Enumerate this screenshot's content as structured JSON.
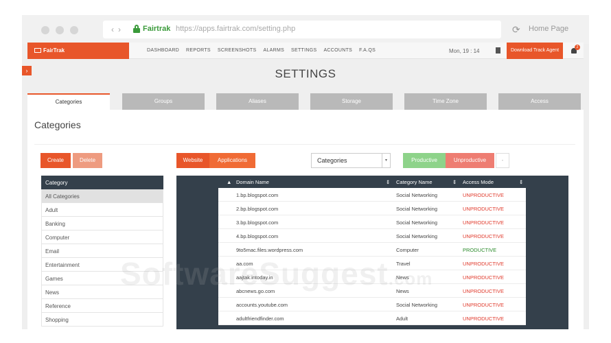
{
  "browser": {
    "site_name": "Fairtrak",
    "url": "https://apps.fairtrak.com/setting.php",
    "home_label": "Home Page"
  },
  "app": {
    "logo": "FairTrak",
    "menu": [
      "DASHBOARD",
      "REPORTS",
      "SCREENSHOTS",
      "ALARMS",
      "SETTINGS",
      "ACCOUNTS",
      "F.A.QS"
    ],
    "time": "Mon, 19 : 14",
    "download_label": "Download Track Agent",
    "notification_count": "2"
  },
  "page": {
    "title": "SETTINGS",
    "tabs": [
      "Categories",
      "Groups",
      "Aliases",
      "Storage",
      "Time Zone",
      "Access"
    ],
    "active_tab": 0,
    "section_title": "Categories"
  },
  "toolbar": {
    "create": "Create",
    "delete": "Delete",
    "website": "Website",
    "applications": "Applications",
    "select_value": "Categories",
    "productive": "Productive",
    "unproductive": "Unproductive",
    "dash": "-"
  },
  "categories": {
    "header": "Category",
    "items": [
      "All Categories",
      "Adult",
      "Banking",
      "Computer",
      "Email",
      "Entertainment",
      "Games",
      "News",
      "Reference",
      "Shopping"
    ],
    "selected": 0
  },
  "domains": {
    "headers": [
      "Domain Name",
      "Category Name",
      "Access Mode"
    ],
    "rows": [
      {
        "domain": "1.bp.blogspot.com",
        "category": "Social Networking",
        "mode": "UNPRODUCTIVE"
      },
      {
        "domain": "2.bp.blogspot.com",
        "category": "Social Networking",
        "mode": "UNPRODUCTIVE"
      },
      {
        "domain": "3.bp.blogspot.com",
        "category": "Social Networking",
        "mode": "UNPRODUCTIVE"
      },
      {
        "domain": "4.bp.blogspot.com",
        "category": "Social Networking",
        "mode": "UNPRODUCTIVE"
      },
      {
        "domain": "9to5mac.files.wordpress.com",
        "category": "Computer",
        "mode": "PRODUCTIVE"
      },
      {
        "domain": "aa.com",
        "category": "Travel",
        "mode": "UNPRODUCTIVE"
      },
      {
        "domain": "aajtak.intoday.in",
        "category": "News",
        "mode": "UNPRODUCTIVE"
      },
      {
        "domain": "abcnews.go.com",
        "category": "News",
        "mode": "UNPRODUCTIVE"
      },
      {
        "domain": "accounts.youtube.com",
        "category": "Social Networking",
        "mode": "UNPRODUCTIVE"
      },
      {
        "domain": "adultfriendfinder.com",
        "category": "Adult",
        "mode": "UNPRODUCTIVE"
      }
    ]
  },
  "watermark": {
    "main": "SoftwareSuggest",
    "suffix": ".com"
  },
  "colors": {
    "accent": "#e8562a",
    "productive": "#2a8a2a",
    "unproductive": "#e0392b",
    "panel": "#34404b"
  }
}
